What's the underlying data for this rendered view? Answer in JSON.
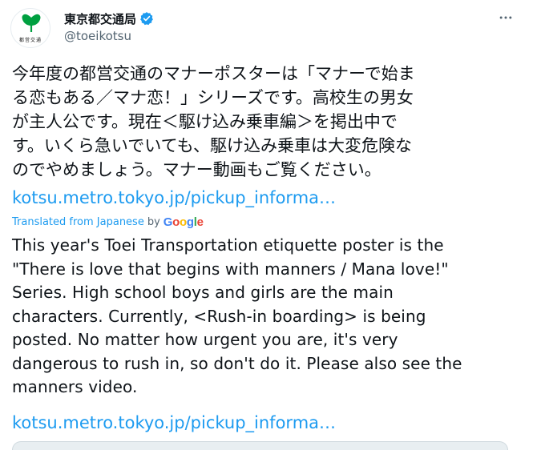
{
  "account": {
    "display_name": "東京都交通局",
    "handle": "@toeikotsu",
    "avatar_caption": "都営交通",
    "verified": true
  },
  "tweet": {
    "text": "今年度の都営交通のマナーポスターは「マナーで始ま\nる恋もある／マナ恋！」シリーズです。高校生の男女\nが主人公です。現在＜駆け込み乗車編＞を掲出中で\nす。いくら急いでいても、駆け込み乗車は大変危険な\nのでやめましょう。マナー動画もご覧ください。",
    "link": "kotsu.metro.tokyo.jp/pickup_informa…"
  },
  "translation": {
    "label": "Translated from Japanese",
    "by": "by",
    "provider": "Google",
    "text": "This year's Toei Transportation etiquette poster is the\n\"There is love that begins with manners / Mana love!\"\nSeries. High school boys and girls are the main\ncharacters. Currently, <Rush-in boarding> is being\nposted. No matter how urgent you are, it's very\ndangerous to rush in, so don't do it. Please also see the\nmanners video.",
    "link": "kotsu.metro.tokyo.jp/pickup_informa…"
  },
  "icons": {
    "verified": "verified-badge-icon",
    "more": "more-options-icon",
    "logo": "ginkgo-leaf-logo"
  },
  "colors": {
    "link": "#1d9bf0",
    "secondary_text": "#536471",
    "logo_green": "#00a040"
  }
}
